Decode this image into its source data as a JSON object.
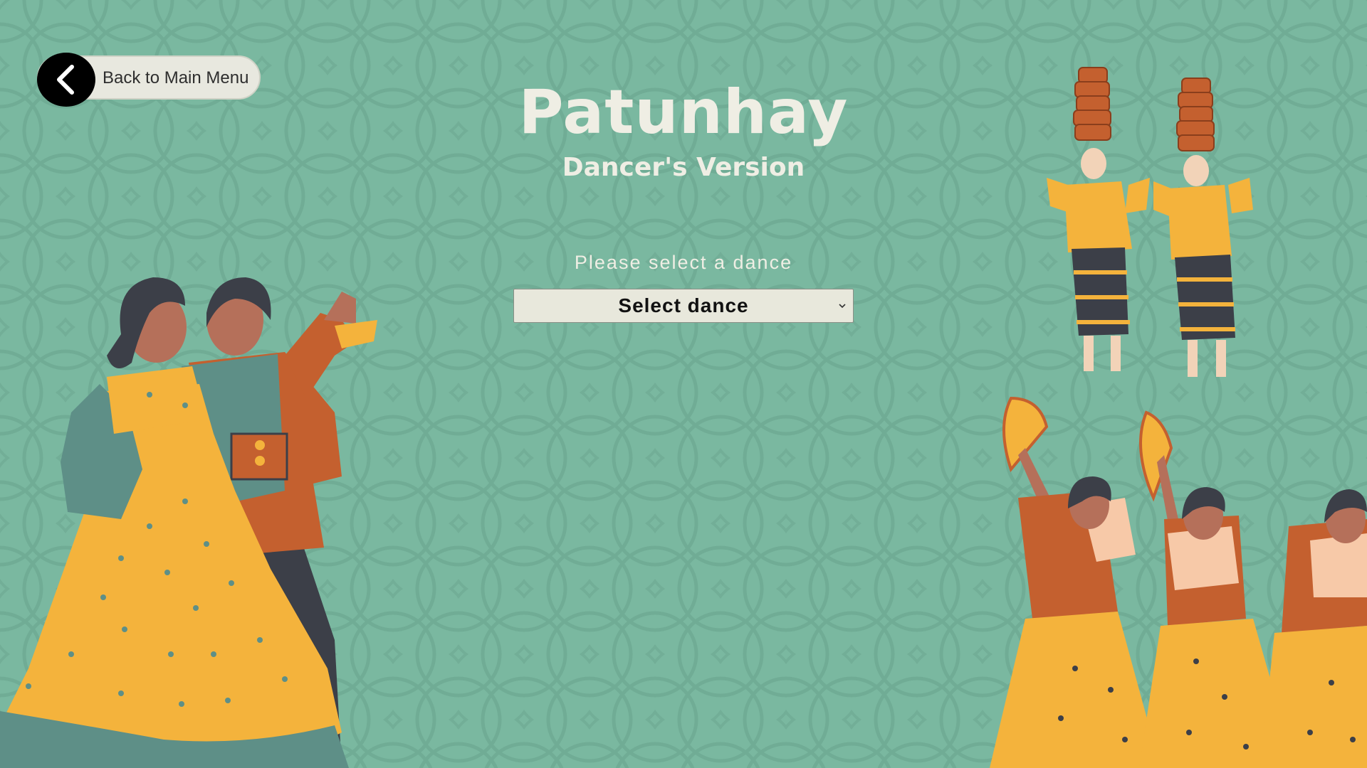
{
  "app": {
    "title": "Patunhay",
    "subtitle": "Dancer's Version"
  },
  "nav": {
    "back_label": "Back to Main Menu",
    "back_icon": "chevron-left-icon"
  },
  "form": {
    "prompt": "Please select a dance",
    "select_value": "Select dance",
    "select_icon": "chevron-down-icon"
  },
  "theme": {
    "background": "#7ab8a0",
    "text_light": "#efeee4",
    "mustard": "#f4b33c",
    "rust": "#c4602f",
    "teal_dark": "#5e8f87",
    "charcoal": "#3c3f48"
  }
}
